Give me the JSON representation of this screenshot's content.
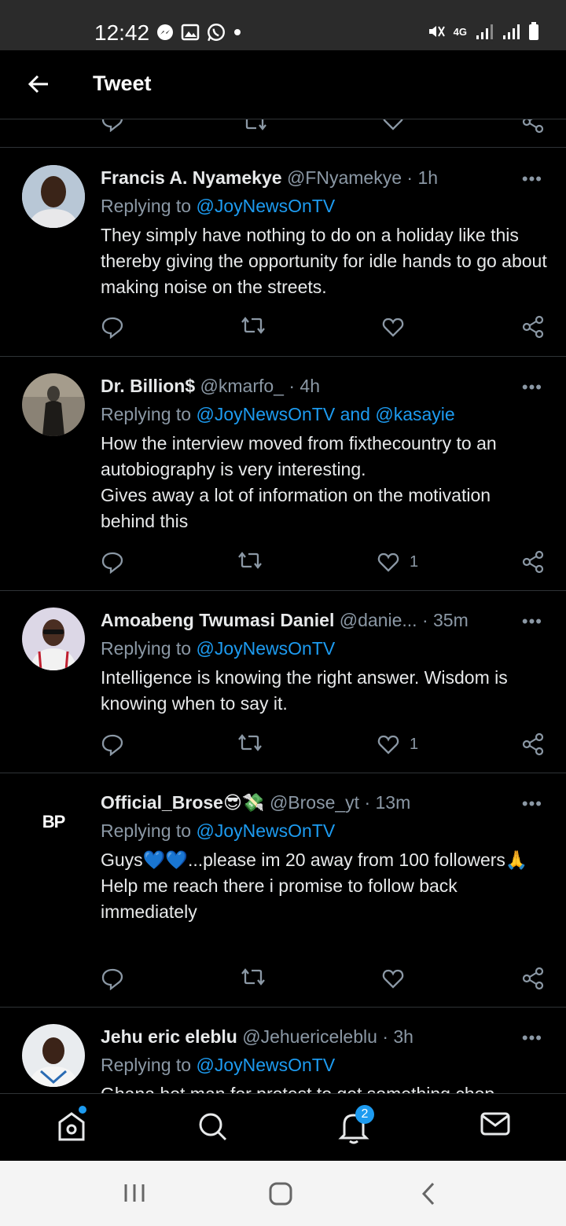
{
  "status": {
    "time": "12:42",
    "network": "4G"
  },
  "appbar": {
    "title": "Tweet"
  },
  "tweets": [
    {
      "name": "Francis A. Nyamekye",
      "handle": "@FNyamekye",
      "time": "· 1h",
      "reply_prefix": "Replying to ",
      "reply_to": "@JoyNewsOnTV",
      "text": "They simply have nothing to do on a holiday like this thereby giving the opportunity for idle hands to go about making noise on the streets.",
      "likes": ""
    },
    {
      "name": "Dr. Billion$",
      "handle": "@kmarfo_",
      "time": "· 4h",
      "reply_prefix": "Replying to ",
      "reply_to": "@JoyNewsOnTV and @kasayie",
      "text": "How the interview moved from fixthecountry to an autobiography is very interesting.\nGives away a lot of information on the motivation behind this",
      "likes": "1"
    },
    {
      "name": "Amoabeng Twumasi Daniel",
      "handle": "@danie...",
      "time": "· 35m",
      "reply_prefix": "Replying to ",
      "reply_to": "@JoyNewsOnTV",
      "text": "Intelligence is knowing the right answer. Wisdom is knowing when to say it.",
      "likes": "1"
    },
    {
      "name": "Official_Brose😎💸",
      "handle": "@Brose_yt",
      "time": "· 13m",
      "reply_prefix": "Replying to ",
      "reply_to": "@JoyNewsOnTV",
      "text": "Guys💙💙...please im 20 away from 100 followers🙏\nHelp me reach there i promise to follow back immediately",
      "likes": "",
      "avatar_text": "BP"
    },
    {
      "name": "Jehu eric eleblu",
      "handle": "@Jehuericeleblu",
      "time": "· 3h",
      "reply_prefix": "Replying to ",
      "reply_to": "@JoyNewsOnTV",
      "text": "Ghana hot man for protest to get something chop"
    }
  ],
  "more_label": "•••",
  "nav": {
    "notifications_badge": "2"
  },
  "colors": {
    "accent": "#1d9bf0",
    "muted": "#8b98a5",
    "divider": "#2f3336"
  }
}
